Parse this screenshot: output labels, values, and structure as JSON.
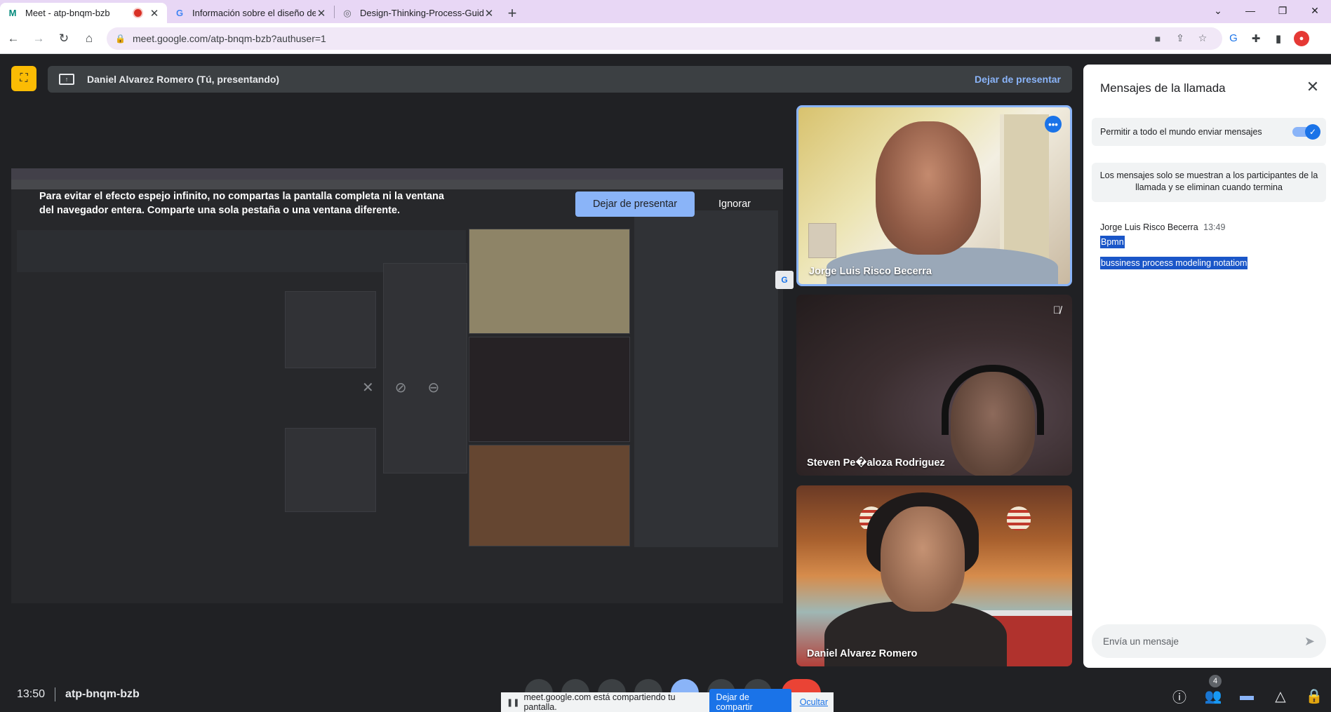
{
  "browser": {
    "tabs": [
      {
        "title": "Meet - atp-bnqm-bzb",
        "favicon": "M",
        "recording": true,
        "active": true
      },
      {
        "title": "Información sobre el diseño de N",
        "favicon": "G",
        "recording": false,
        "active": false
      },
      {
        "title": "Design-Thinking-Process-Guide.p",
        "favicon": "◎",
        "recording": false,
        "active": false
      }
    ],
    "url": "meet.google.com/atp-bnqm-bzb?authuser=1"
  },
  "presentation": {
    "presenter": "Daniel Alvarez Romero (Tú, presentando)",
    "stop_label": "Dejar de presentar"
  },
  "warning": {
    "text": "Para evitar el efecto espejo infinito, no compartas la pantalla completa ni la ventana del navegador entera. Comparte una sola pestaña o una ventana diferente.",
    "stop_label": "Dejar de presentar",
    "ignore_label": "Ignorar"
  },
  "participants": [
    {
      "name": "Jorge Luis Risco Becerra"
    },
    {
      "name": "Steven Pe�aloza Rodriguez"
    },
    {
      "name": "Daniel Alvarez Romero"
    }
  ],
  "chat": {
    "title": "Mensajes de la llamada",
    "allow_label": "Permitir a todo el mundo enviar mensajes",
    "allow_enabled": true,
    "notice": "Los mensajes solo se muestran a los participantes de la llamada y se eliminan cuando termina",
    "author": "Jorge Luis Risco Becerra",
    "time": "13:49",
    "messages": [
      "Bpmn",
      "bussiness process modeling notatiom"
    ],
    "compose_placeholder": "Envía un mensaje"
  },
  "footer": {
    "time": "13:50",
    "meeting_code": "atp-bnqm-bzb",
    "share_text": "meet.google.com está compartiendo tu pantalla.",
    "stop_share_label": "Dejar de compartir",
    "hide_label": "Ocultar",
    "participant_count": "4"
  },
  "colors": {
    "accent": "#8ab4f8",
    "primary_blue": "#1a73e8",
    "present_yellow": "#fbbc04",
    "meet_bg": "#202124"
  }
}
